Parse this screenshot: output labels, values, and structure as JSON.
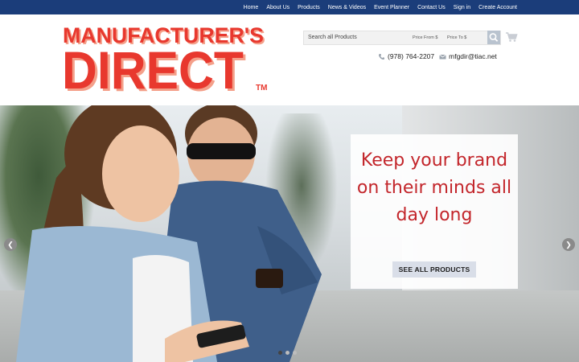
{
  "topnav": {
    "items": [
      "Home",
      "About Us",
      "Products",
      "News & Videos",
      "Event Planner",
      "Contact Us",
      "Sign in",
      "Create Account"
    ]
  },
  "logo": {
    "line1": "MANUFACTURER'S",
    "line2": "DIRECT",
    "tm": "TM",
    "color": "#e8382e",
    "shadow_color": "#f4a08a"
  },
  "search": {
    "placeholder": "Search all Products",
    "price_from": "Price From $",
    "price_to": "Price To $"
  },
  "contact": {
    "phone": "(978) 764-2207",
    "email": "mfgdir@tiac.net"
  },
  "hero": {
    "headline": "Keep your brand on their minds all day long",
    "cta": "SEE ALL PRODUCTS",
    "slide_count": 3,
    "active_slide": 1,
    "headline_color": "#c3262b"
  },
  "colors": {
    "topnav_bg": "#1b3d7a",
    "accent": "#c3262b"
  },
  "icons": [
    "phone-icon",
    "email-icon",
    "search-icon",
    "cart-icon",
    "chevron-left-icon",
    "chevron-right-icon"
  ]
}
